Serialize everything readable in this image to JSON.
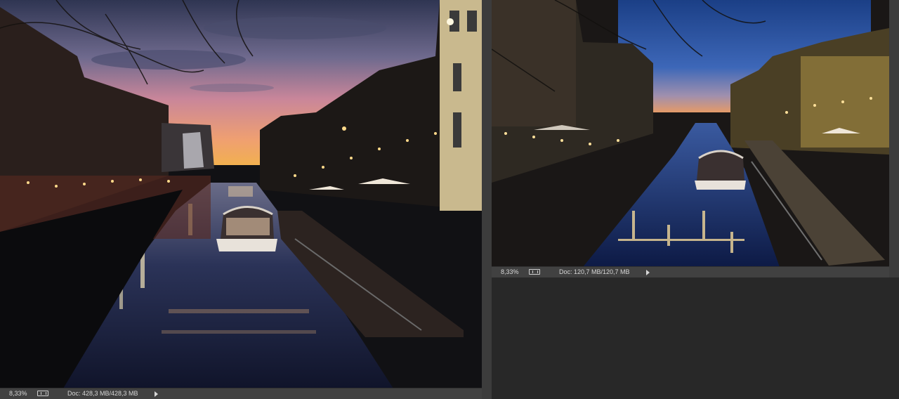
{
  "app": {
    "background": "#282828"
  },
  "left_document": {
    "zoom": "8,33%",
    "doc_info": "Doc: 428,3 MB/428,3 MB",
    "status_icon": "info-toggle-icon",
    "status_arrow_icon": "arrow-right-icon",
    "image_subject": "Night view of Naviglio canal with lights"
  },
  "right_document": {
    "zoom": "8,33%",
    "doc_info": "Doc: 120,7 MB/120,7 MB",
    "status_icon": "info-toggle-icon",
    "status_arrow_icon": "arrow-right-icon",
    "image_subject": "Blue hour view of Naviglio canal with lights"
  }
}
